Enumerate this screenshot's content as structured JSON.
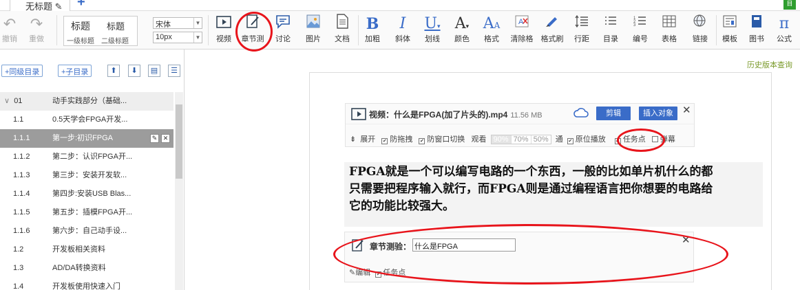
{
  "tabs": {
    "doc_tab_label": "无标题",
    "add_tab_label": "+",
    "corner_badge": "目"
  },
  "toolbar": {
    "undo": "撤销",
    "redo": "重做",
    "heading1": "标题",
    "heading1_sub": "一级标题",
    "heading2": "标题",
    "heading2_sub": "二级标题",
    "font_family": "宋体",
    "font_size": "10px",
    "buttons": [
      "视频",
      "章节测",
      "讨论",
      "图片",
      "文档",
      "加粗",
      "斜体",
      "划线",
      "颜色",
      "格式",
      "清除格",
      "格式刷",
      "行距",
      "目录",
      "编号",
      "表格",
      "链接",
      "模板",
      "图书",
      "公式"
    ]
  },
  "sidebar": {
    "add_sibling": "+同级目录",
    "add_child": "+子目录",
    "toc": [
      {
        "num": "01",
        "title": "动手实践部分（基础..."
      },
      {
        "num": "1.1",
        "title": "0.5天学会FPGA开发..."
      },
      {
        "num": "1.1.1",
        "title": "第一步:初识FPGA"
      },
      {
        "num": "1.1.2",
        "title": "第二步：认识FPGA开..."
      },
      {
        "num": "1.1.3",
        "title": "第三步：安装开发软..."
      },
      {
        "num": "1.1.4",
        "title": "第四步:安装USB Blas..."
      },
      {
        "num": "1.1.5",
        "title": "第五步：插模FPGA开..."
      },
      {
        "num": "1.1.6",
        "title": "第六步：自己动手设..."
      },
      {
        "num": "1.2",
        "title": "开发板相关资料"
      },
      {
        "num": "1.3",
        "title": "AD/DA转换资料"
      },
      {
        "num": "1.4",
        "title": "开发板使用快速入门"
      }
    ]
  },
  "main": {
    "history_link": "历史版本查询",
    "video": {
      "title": "视频：什么是FPGA(加了片头的).mp4",
      "size": "11.56 MB",
      "cut_button": "剪辑",
      "insert_button": "插入对象",
      "expand": "展开",
      "no_drag": "防拖拽",
      "window_switch": "防窗口切换",
      "watch_label": "观看",
      "percents": [
        "90%",
        "70%",
        "50%"
      ],
      "pass_label": "通",
      "original_speed": "原位播放",
      "task_point": "任务点",
      "bullet_comments": "弹幕"
    },
    "body_lines": [
      "FPGA就是一个可以编写电路的一个东西，一般的比如单片机什么的都",
      "只需要把程序输入就行，而FPGA则是通过编程语言把你想要的电路给",
      "它的功能比较强大。"
    ],
    "quiz": {
      "label": "章节测验：",
      "value": "什么是FPGA",
      "edit": "编辑",
      "task_point": "任务点"
    }
  },
  "colors": {
    "accent": "#3a6cc8",
    "annotation_red": "#e8141b",
    "active_row": "#9c9c9c"
  }
}
